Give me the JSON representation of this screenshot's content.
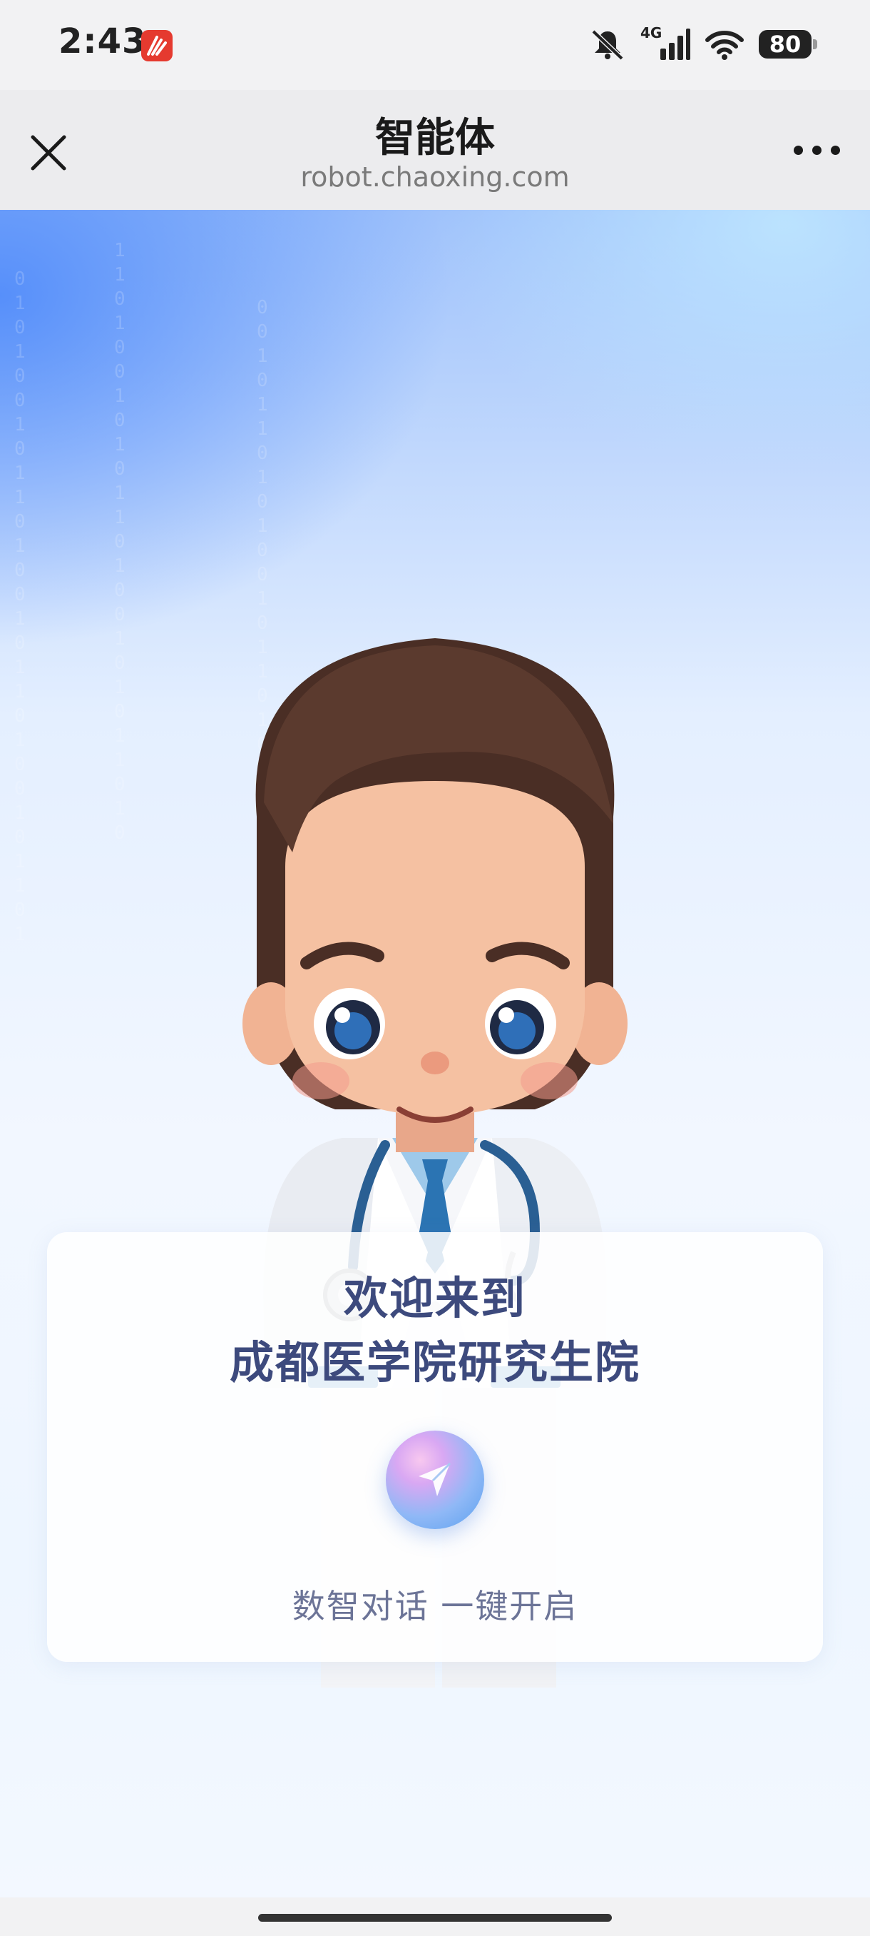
{
  "status_bar": {
    "time": "2:43",
    "network": "4G",
    "battery": "80",
    "icons": [
      "app-notification-icon",
      "mute-icon",
      "signal-icon",
      "wifi-icon",
      "battery-icon"
    ]
  },
  "nav": {
    "title": "智能体",
    "url": "robot.chaoxing.com",
    "icons": [
      "close-icon",
      "more-icon"
    ]
  },
  "hero": {
    "illustration": "doctor-avatar-illustration"
  },
  "card": {
    "welcome_line1": "欢迎来到",
    "welcome_line2": "成都医学院研究生院",
    "cta": "数智对话 一键开启",
    "button_icon": "send-icon"
  },
  "colors": {
    "accent_blue": "#5a8ff5",
    "title_text": "#3d4a7d",
    "app_icon_red": "#e53a2f"
  }
}
